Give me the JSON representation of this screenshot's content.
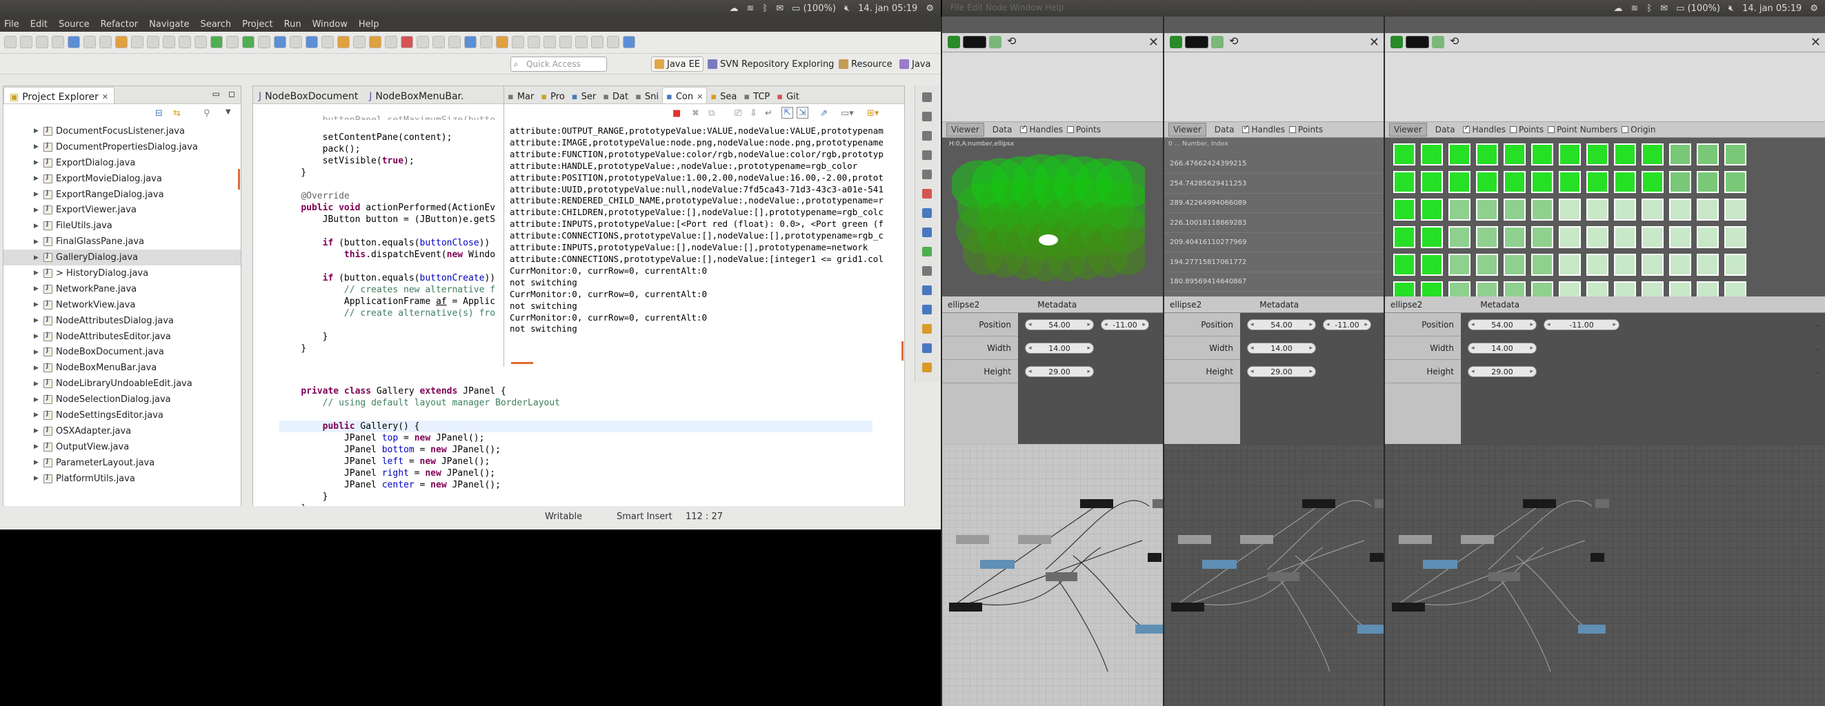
{
  "panel": {
    "clock": "14. jan 05:19",
    "battery": "(100%)"
  },
  "eclipse": {
    "menu": [
      "File",
      "Edit",
      "Source",
      "Refactor",
      "Navigate",
      "Search",
      "Project",
      "Run",
      "Window",
      "Help"
    ],
    "quick_access_placeholder": "Quick Access",
    "perspectives": [
      "Java EE",
      "SVN Repository Exploring",
      "Resource",
      "Java"
    ],
    "explorer": {
      "title": "Project Explorer",
      "files": [
        "DocumentFocusListener.java",
        "DocumentPropertiesDialog.java",
        "ExportDialog.java",
        "ExportMovieDialog.java",
        "ExportRangeDialog.java",
        "ExportViewer.java",
        "FileUtils.java",
        "FinalGlassPane.java",
        "GalleryDialog.java",
        "> HistoryDialog.java",
        "NetworkPane.java",
        "NetworkView.java",
        "NodeAttributesDialog.java",
        "NodeAttributesEditor.java",
        "NodeBoxDocument.java",
        "NodeBoxMenuBar.java",
        "NodeLibraryUndoableEdit.java",
        "NodeSelectionDialog.java",
        "NodeSettingsEditor.java",
        "OSXAdapter.java",
        "OutputView.java",
        "ParameterLayout.java",
        "PlatformUtils.java"
      ],
      "selected_index": 8
    },
    "editor_tabs": [
      "NodeBoxDocument",
      "NodeBoxMenuBar."
    ],
    "console_tabs": [
      "Mar",
      "Pro",
      "Ser",
      "Dat",
      "Sni",
      "Con",
      "Sea",
      "TCP",
      "Git"
    ],
    "console_lines": [
      "attribute:OUTPUT_RANGE,prototypeValue:VALUE,nodeValue:VALUE,prototypenam",
      "attribute:IMAGE,prototypeValue:node.png,nodeValue:node.png,prototypename",
      "attribute:FUNCTION,prototypeValue:color/rgb,nodeValue:color/rgb,prototyp",
      "attribute:HANDLE,prototypeValue:,nodeValue:,prototypename=rgb_color",
      "attribute:POSITION,prototypeValue:1.00,2.00,nodeValue:16.00,-2.00,protot",
      "attribute:UUID,prototypeValue:null,nodeValue:7fd5ca43-71d3-43c3-a01e-541",
      "attribute:RENDERED_CHILD_NAME,prototypeValue:,nodeValue:,prototypename=r",
      "attribute:CHILDREN,prototypeValue:[],nodeValue:[],prototypename=rgb_colc",
      "attribute:INPUTS,prototypeValue:[<Port red (float): 0.0>, <Port green (f",
      "attribute:CONNECTIONS,prototypeValue:[],nodeValue:[],prototypename=rgb_c",
      "attribute:INPUTS,prototypeValue:[],nodeValue:[],prototypename=network",
      "attribute:CONNECTIONS,prototypeValue:[],nodeValue:[integer1 <= grid1.col",
      "CurrMonitor:0, currRow=0, currentAlt:0",
      "not switching",
      "CurrMonitor:0, currRow=0, currentAlt:0",
      "not switching",
      "CurrMonitor:0, currRow=0, currentAlt:0",
      "not switching"
    ],
    "status": {
      "mode": "Writable",
      "insert": "Smart Insert",
      "position": "112 : 27"
    }
  },
  "nodebox": {
    "viewer_tabs": [
      "Viewer",
      "Data"
    ],
    "opts": {
      "handles": "Handles",
      "points": "Points",
      "point_numbers": "Point Numbers",
      "origin": "Origin"
    },
    "port_tab_node": "ellipse2",
    "port_tab_meta": "Metadata",
    "ports": [
      {
        "label": "Position",
        "x": "54.00",
        "y": "-11.00"
      },
      {
        "label": "Width",
        "v": "14.00"
      },
      {
        "label": "Height",
        "v": "29.00"
      }
    ],
    "win1_caption": "H:0,A:number,ellipsx",
    "data_values": [
      "266.47662424399215",
      "254.74285629411253",
      "289.42264994066089",
      "226.10018118869283",
      "209.40416110277969",
      "194.27715817061772",
      "180.89569414640867"
    ],
    "data_header": "0 ... Number, Index"
  }
}
